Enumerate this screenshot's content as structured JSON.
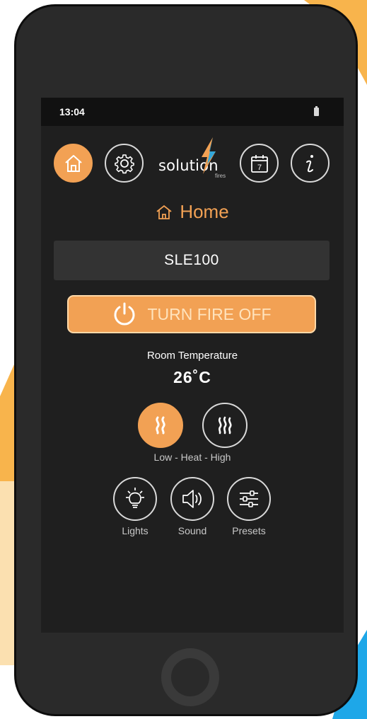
{
  "status_bar": {
    "time": "13:04"
  },
  "header": {
    "home_icon": "home-icon",
    "settings_icon": "gear-icon",
    "calendar_icon": "calendar-icon",
    "calendar_day": "7",
    "info_icon": "info-icon",
    "logo": {
      "text": "solution",
      "subtext": "fires"
    }
  },
  "page": {
    "title": "Home"
  },
  "device": {
    "name": "SLE100"
  },
  "power_button": {
    "label": "TURN FIRE OFF"
  },
  "temperature": {
    "label": "Room Temperature",
    "value": "26˚C"
  },
  "heat": {
    "label": "Low - Heat - High",
    "low_icon": "heat-low-icon",
    "high_icon": "heat-high-icon",
    "selected": "low"
  },
  "controls": [
    {
      "label": "Lights",
      "icon": "lightbulb-icon"
    },
    {
      "label": "Sound",
      "icon": "speaker-icon"
    },
    {
      "label": "Presets",
      "icon": "sliders-icon"
    }
  ],
  "colors": {
    "accent": "#f2a154",
    "screen_bg": "#1f1f1f",
    "panel": "#333333"
  }
}
